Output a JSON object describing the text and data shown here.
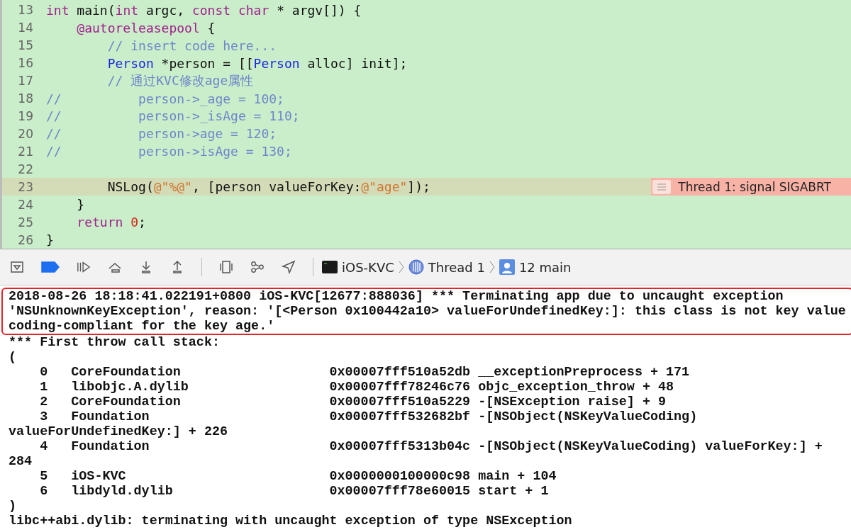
{
  "editor": {
    "lines": [
      {
        "number": "13",
        "tokens": [
          {
            "kind": "keyword",
            "text": "int"
          },
          {
            "kind": "plain",
            "text": " main("
          },
          {
            "kind": "keyword",
            "text": "int"
          },
          {
            "kind": "plain",
            "text": " argc, "
          },
          {
            "kind": "keyword",
            "text": "const char"
          },
          {
            "kind": "plain",
            "text": " * argv[]) {"
          }
        ]
      },
      {
        "number": "14",
        "tokens": [
          {
            "kind": "keyword",
            "text": "    @autoreleasepool"
          },
          {
            "kind": "plain",
            "text": " {"
          }
        ]
      },
      {
        "number": "15",
        "tokens": [
          {
            "kind": "comment",
            "text": "        // insert code here..."
          }
        ]
      },
      {
        "number": "16",
        "tokens": [
          {
            "kind": "type",
            "text": "        Person"
          },
          {
            "kind": "plain",
            "text": " *person = [["
          },
          {
            "kind": "type",
            "text": "Person"
          },
          {
            "kind": "plain",
            "text": " alloc] init];"
          }
        ]
      },
      {
        "number": "17",
        "tokens": [
          {
            "kind": "comment",
            "text": "        // 通过KVC修改age属性"
          }
        ]
      },
      {
        "number": "18",
        "tokens": [
          {
            "kind": "comment",
            "text": "//          person->_age = 100;"
          }
        ]
      },
      {
        "number": "19",
        "tokens": [
          {
            "kind": "comment",
            "text": "//          person->_isAge = 110;"
          }
        ]
      },
      {
        "number": "20",
        "tokens": [
          {
            "kind": "comment",
            "text": "//          person->age = 120;"
          }
        ]
      },
      {
        "number": "21",
        "tokens": [
          {
            "kind": "comment",
            "text": "//          person->isAge = 130;"
          }
        ]
      },
      {
        "number": "22"
      },
      {
        "number": "23",
        "current": true,
        "tokens": [
          {
            "kind": "plain",
            "text": "        NSLog("
          },
          {
            "kind": "string",
            "text": "@\"%@\""
          },
          {
            "kind": "plain",
            "text": ", [person valueForKey:"
          },
          {
            "kind": "string",
            "text": "@\"age\""
          },
          {
            "kind": "plain",
            "text": "]);"
          }
        ],
        "annotation": "Thread 1: signal SIGABRT"
      },
      {
        "number": "24",
        "tokens": [
          {
            "kind": "plain",
            "text": "    }"
          }
        ]
      },
      {
        "number": "25",
        "tokens": [
          {
            "kind": "keyword",
            "text": "    return"
          },
          {
            "kind": "number",
            "text": " 0"
          },
          {
            "kind": "plain",
            "text": ";"
          }
        ]
      },
      {
        "number": "26",
        "tokens": [
          {
            "kind": "plain",
            "text": "}"
          }
        ]
      }
    ]
  },
  "debug_bar": {
    "breakpoints_active": true,
    "path": [
      {
        "kind": "app",
        "label": "iOS-KVC"
      },
      {
        "kind": "thread",
        "label": "Thread 1"
      },
      {
        "kind": "frame",
        "label": "12 main"
      }
    ]
  },
  "console": {
    "exception_message": "2018-08-26 18:18:41.022191+0800 iOS-KVC[12677:888036] *** Terminating app due to uncaught exception 'NSUnknownKeyException', reason: '[<Person 0x100442a10> valueForUndefinedKey:]: this class is not key value coding-compliant for the key age.'",
    "stack_header": "*** First throw call stack:",
    "open_paren": "(",
    "frames": [
      {
        "index": "0",
        "library": "CoreFoundation",
        "address": "0x00007fff510a52db",
        "symbol": "__exceptionPreprocess + 171"
      },
      {
        "index": "1",
        "library": "libobjc.A.dylib",
        "address": "0x00007fff78246c76",
        "symbol": "objc_exception_throw + 48"
      },
      {
        "index": "2",
        "library": "CoreFoundation",
        "address": "0x00007fff510a5229",
        "symbol": "-[NSException raise] + 9"
      },
      {
        "index": "3",
        "library": "Foundation",
        "address": "0x00007fff532682bf",
        "symbol": "-[NSObject(NSKeyValueCoding) valueForUndefinedKey:] + 226"
      },
      {
        "index": "4",
        "library": "Foundation",
        "address": "0x00007fff5313b04c",
        "symbol": "-[NSObject(NSKeyValueCoding) valueForKey:] + 284"
      },
      {
        "index": "5",
        "library": "iOS-KVC",
        "address": "0x0000000100000c98",
        "symbol": "main + 104"
      },
      {
        "index": "6",
        "library": "libdyld.dylib",
        "address": "0x00007fff78e60015",
        "symbol": "start + 1"
      }
    ],
    "close_paren": ")",
    "footer": "libc++abi.dylib: terminating with uncaught exception of type NSException"
  }
}
